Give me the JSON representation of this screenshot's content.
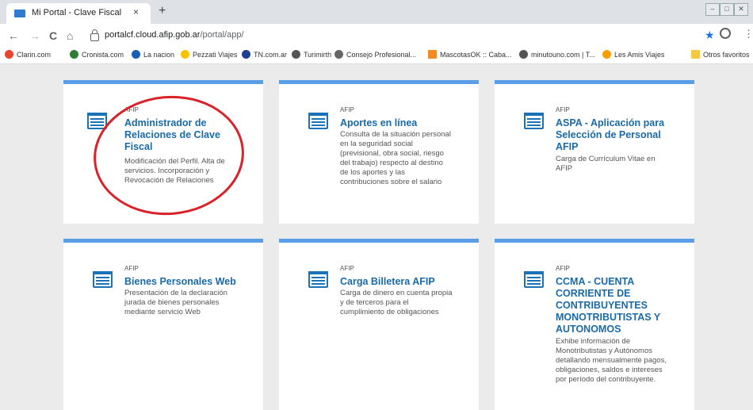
{
  "browser": {
    "tab_title": "Mi Portal - Clave Fiscal",
    "tab_close": "×",
    "new_tab": "+",
    "url_domain": "portalcf.cloud.afip.gob.ar",
    "url_path": "/portal/app/",
    "nav_back": "←",
    "nav_forward": "→",
    "nav_reload": "C",
    "nav_home": "⌂",
    "star": "★",
    "kebab": "⋮",
    "win_min": "‒",
    "win_max": "□",
    "win_close": "✕"
  },
  "bookmarks": [
    {
      "label": "Clarin.com",
      "color": "#e8442e"
    },
    {
      "label": "Cronista.com",
      "color": "#2e7d32"
    },
    {
      "label": "La nacion",
      "color": "#1a5fb4"
    },
    {
      "label": "Pezzati Viajes",
      "color": "#f5c400"
    },
    {
      "label": "TN.com.ar",
      "color": "#1c3f94"
    },
    {
      "label": "Turimirth",
      "color": "#555555"
    },
    {
      "label": "Consejo Profesional...",
      "color": "#666666"
    },
    {
      "label": "MascotasOK :: Caba...",
      "color": "#f08a24"
    },
    {
      "label": "minutouno.com | T...",
      "color": "#555555"
    },
    {
      "label": "Les Amis Viajes",
      "color": "#f5a000"
    },
    {
      "label": "Otros favoritos",
      "color": "#f5c842"
    }
  ],
  "cards": [
    {
      "org": "AFIP",
      "title": [
        "Administrador de",
        "Relaciones de Clave",
        "Fiscal"
      ],
      "desc": [
        "Modificación del Perfil. Alta de",
        "servicios. Incorporación y",
        "Revocación de Relaciones"
      ]
    },
    {
      "org": "AFIP",
      "title": [
        "Aportes en línea"
      ],
      "desc": [
        "Consulta de la situación personal",
        "en la seguridad social",
        "(previsional, obra social, riesgo",
        "del trabajo) respecto al destino",
        "de los aportes y las",
        "contribuciones sobre el salario"
      ]
    },
    {
      "org": "AFIP",
      "title": [
        "ASPA - Aplicación para",
        "Selección de Personal",
        "AFIP"
      ],
      "desc": [
        "Carga de Currículum Vitae en",
        "AFIP"
      ]
    },
    {
      "org": "AFIP",
      "title": [
        "Bienes Personales Web"
      ],
      "desc": [
        "Presentación de la declaración",
        "jurada de bienes personales",
        "mediante servicio Web"
      ]
    },
    {
      "org": "AFIP",
      "title": [
        "Carga Billetera AFIP"
      ],
      "desc": [
        "Carga de dinero en cuenta propia",
        "y de terceros para el",
        "cumplimiento de obligaciones"
      ]
    },
    {
      "org": "AFIP",
      "title": [
        "CCMA - CUENTA",
        "CORRIENTE DE",
        "CONTRIBUYENTES",
        "MONOTRIBUTISTAS Y",
        "AUTONOMOS"
      ],
      "desc": [
        "Exhibe información de",
        "Monotributistas y Autónomos",
        "detallando mensualmente pagos,",
        "obligaciones, saldos e intereses",
        "por período del contribuyente."
      ]
    }
  ]
}
